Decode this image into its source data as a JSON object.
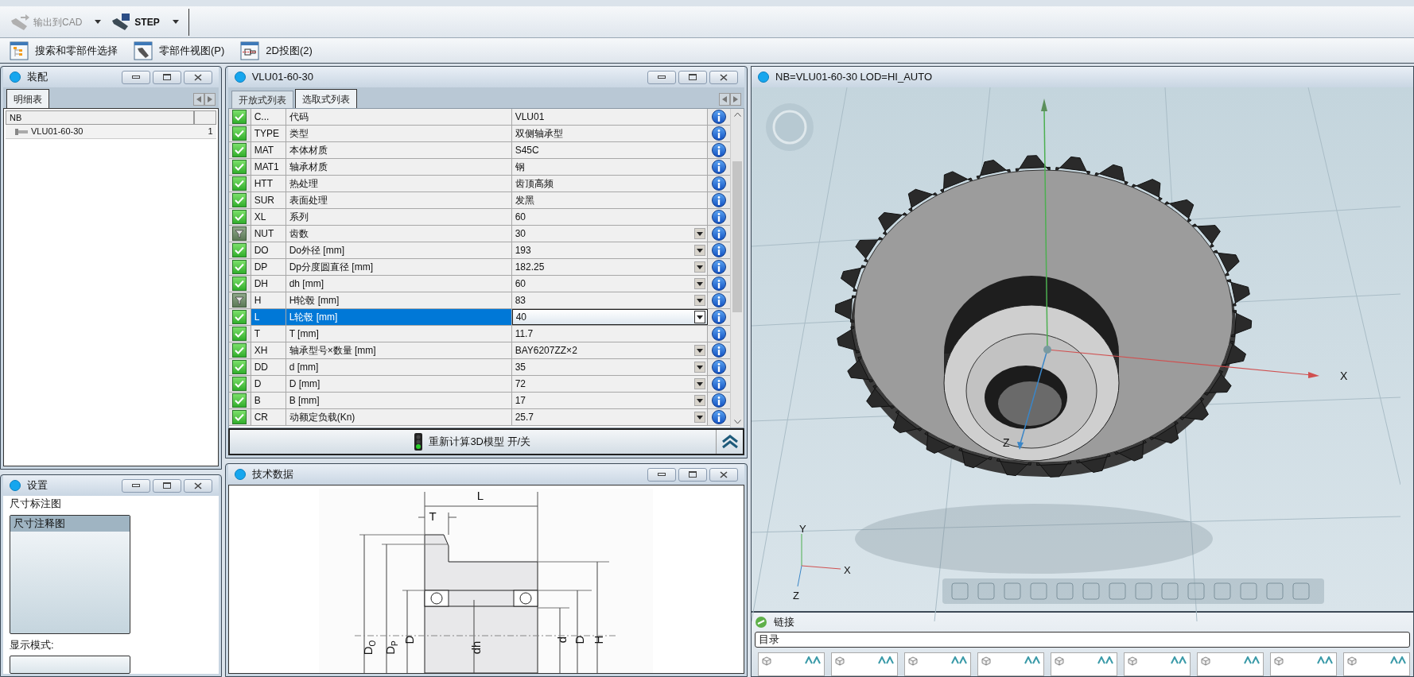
{
  "toolbar_top": [
    {
      "label": "输出到CAD",
      "disabled": true,
      "dropdown": true
    },
    {
      "label": "STEP",
      "disabled": false,
      "dropdown": true
    }
  ],
  "toolbar_nav": [
    {
      "label": "搜索和零部件选择",
      "kind": "tree"
    },
    {
      "label": "零部件视图(P)",
      "kind": "part"
    },
    {
      "label": "2D投图(2)",
      "kind": "drawing"
    }
  ],
  "assembly_panel": {
    "title": "装配",
    "tabs": [
      {
        "label": "明细表",
        "selected": true
      }
    ],
    "columns": [
      "NB"
    ],
    "rows": [
      {
        "name": "VLU01-60-30",
        "count": "1"
      }
    ]
  },
  "parameter_panel": {
    "title": "VLU01-60-30",
    "tabs": [
      {
        "label": "开放式列表",
        "selected": false
      },
      {
        "label": "选取式列表",
        "selected": true
      }
    ],
    "rows": [
      {
        "kind": "check",
        "code": "C...",
        "name": "代码",
        "value": "VLU01",
        "dropdown": false,
        "selected": false
      },
      {
        "kind": "check",
        "code": "TYPE",
        "name": "类型",
        "value": "双侧轴承型",
        "dropdown": false,
        "selected": false
      },
      {
        "kind": "check",
        "code": "MAT",
        "name": "本体材质",
        "value": "S45C",
        "dropdown": false,
        "selected": false
      },
      {
        "kind": "check",
        "code": "MAT1",
        "name": "轴承材质",
        "value": "钢",
        "dropdown": false,
        "selected": false
      },
      {
        "kind": "check",
        "code": "HTT",
        "name": "热处理",
        "value": "齿顶高频",
        "dropdown": false,
        "selected": false
      },
      {
        "kind": "check",
        "code": "SUR",
        "name": "表面处理",
        "value": "发黑",
        "dropdown": false,
        "selected": false
      },
      {
        "kind": "check",
        "code": "XL",
        "name": "系列",
        "value": "60",
        "dropdown": false,
        "selected": false
      },
      {
        "kind": "filter",
        "code": "NUT",
        "name": "齿数",
        "value": "30",
        "dropdown": true,
        "selected": false
      },
      {
        "kind": "check",
        "code": "DO",
        "name": "Do外径 [mm]",
        "value": "193",
        "dropdown": true,
        "selected": false
      },
      {
        "kind": "check",
        "code": "DP",
        "name": "Dp分度圆直径 [mm]",
        "value": "182.25",
        "dropdown": true,
        "selected": false
      },
      {
        "kind": "check",
        "code": "DH",
        "name": "dh [mm]",
        "value": "60",
        "dropdown": true,
        "selected": false
      },
      {
        "kind": "filter",
        "code": "H",
        "name": "H轮毂 [mm]",
        "value": "83",
        "dropdown": true,
        "selected": false
      },
      {
        "kind": "check",
        "code": "L",
        "name": "L轮毂 [mm]",
        "value": "40",
        "dropdown": true,
        "selected": true
      },
      {
        "kind": "check",
        "code": "T",
        "name": "T [mm]",
        "value": "11.7",
        "dropdown": false,
        "selected": false
      },
      {
        "kind": "check",
        "code": "XH",
        "name": "轴承型号×数量 [mm]",
        "value": "BAY6207ZZ×2",
        "dropdown": true,
        "selected": false
      },
      {
        "kind": "check",
        "code": "DD",
        "name": "d [mm]",
        "value": "35",
        "dropdown": true,
        "selected": false
      },
      {
        "kind": "check",
        "code": "D",
        "name": "D [mm]",
        "value": "72",
        "dropdown": true,
        "selected": false
      },
      {
        "kind": "check",
        "code": "B",
        "name": "B [mm]",
        "value": "17",
        "dropdown": true,
        "selected": false
      },
      {
        "kind": "check",
        "code": "CR",
        "name": "动额定负载(Kn)",
        "value": "25.7",
        "dropdown": true,
        "selected": false
      }
    ],
    "recalc_button": "重新计算3D模型 开/关"
  },
  "settings_panel": {
    "title": "设置",
    "dimension_label": "尺寸标注图",
    "dimension_options": [
      {
        "label": "尺寸注释图",
        "selected": true
      }
    ],
    "display_mode_label": "显示模式:"
  },
  "tech_data_panel": {
    "title": "技术数据",
    "dimension_labels": [
      {
        "text": "L"
      },
      {
        "text": "T"
      },
      {
        "text": "D",
        "subscript": "O"
      },
      {
        "text": "D",
        "subscript": "P"
      },
      {
        "text": "D"
      },
      {
        "text": "dh"
      },
      {
        "text": "d"
      },
      {
        "text": "D"
      },
      {
        "text": "H"
      }
    ]
  },
  "viewer_panel": {
    "title": "NB=VLU01-60-30 LOD=HI_AUTO",
    "axis_labels": {
      "x": "X",
      "z": "Z"
    },
    "triad_labels": {
      "y": "Y",
      "x": "X",
      "z": "Z"
    }
  },
  "links_panel": {
    "title": "链接",
    "catalog_label": "目录"
  }
}
